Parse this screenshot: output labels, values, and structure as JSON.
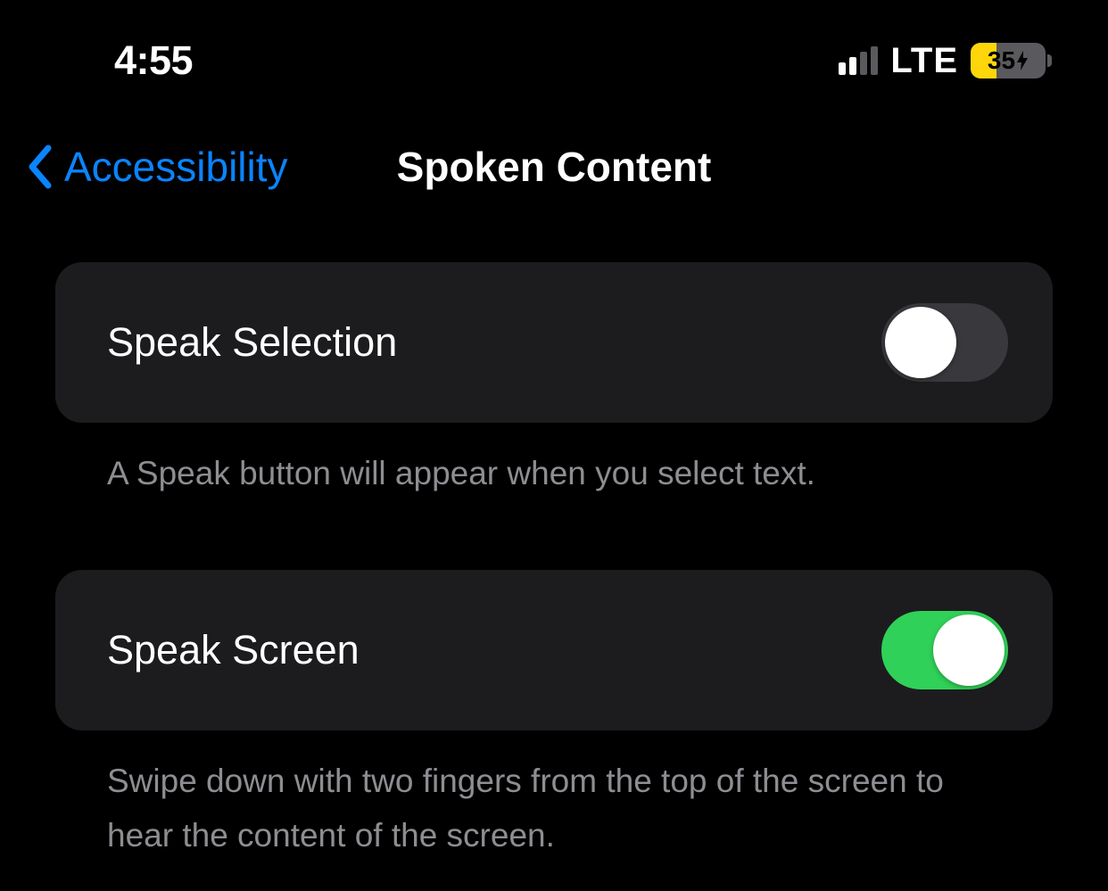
{
  "statusBar": {
    "time": "4:55",
    "network": "LTE",
    "batteryPercent": "35",
    "batteryCharging": true
  },
  "nav": {
    "backLabel": "Accessibility",
    "title": "Spoken Content"
  },
  "settings": {
    "speakSelection": {
      "label": "Speak Selection",
      "enabled": false,
      "description": "A Speak button will appear when you select text."
    },
    "speakScreen": {
      "label": "Speak Screen",
      "enabled": true,
      "description": "Swipe down with two fingers from the top of the screen to hear the content of the screen."
    }
  }
}
